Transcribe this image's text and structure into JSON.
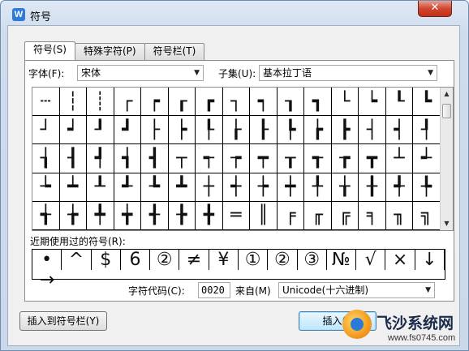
{
  "window": {
    "title": "符号",
    "app_icon_letter": "W",
    "close_glyph": "✕"
  },
  "tabs": [
    {
      "label": "符号(S)",
      "active": true
    },
    {
      "label": "特殊字符(P)",
      "active": false
    },
    {
      "label": "符号栏(T)",
      "active": false
    }
  ],
  "font": {
    "label": "字体(F):",
    "value": "宋体"
  },
  "subset": {
    "label": "子集(U):",
    "value": "基本拉丁语"
  },
  "symbols": [
    "┄",
    "┆",
    "┊",
    "┌",
    "┍",
    "┎",
    "┏",
    "┐",
    "┑",
    "┒",
    "┓",
    "└",
    "┕",
    "┖",
    "┗",
    "┘",
    "┙",
    "┚",
    "┛",
    "├",
    "┝",
    "┞",
    "┟",
    "┠",
    "┡",
    "┢",
    "┣",
    "┤",
    "┥",
    "┦",
    "┧",
    "┨",
    "┩",
    "┪",
    "┫",
    "┬",
    "┭",
    "┮",
    "┯",
    "┰",
    "┱",
    "┲",
    "┳",
    "┴",
    "┵",
    "┶",
    "┷",
    "┸",
    "┹",
    "┺",
    "┻",
    "┼",
    "┽",
    "┾",
    "┿",
    "╀",
    "╁",
    "╂",
    "╃",
    "╄",
    "╅",
    "╆",
    "╇",
    "╈",
    "╉",
    "╊",
    "╋",
    "═",
    "║",
    "╒",
    "╓",
    "╔",
    "╕",
    "╖",
    "╗"
  ],
  "recent": {
    "label": "近期使用过的符号(R):",
    "items": [
      "•",
      "^",
      "$",
      "6",
      "②",
      "≠",
      "¥",
      "①",
      "②",
      "③",
      "№",
      "√",
      "×",
      "↓",
      "→"
    ]
  },
  "char_code": {
    "label": "字符代码(C):",
    "value": "0020"
  },
  "from": {
    "label": "来自(M)",
    "value": "Unicode(十六进制)"
  },
  "buttons": {
    "insert_to_bar": "插入到符号栏(Y)",
    "insert": "插入(I)"
  },
  "watermark": {
    "name": "飞沙系统网",
    "url": "www.fs0745.com"
  }
}
